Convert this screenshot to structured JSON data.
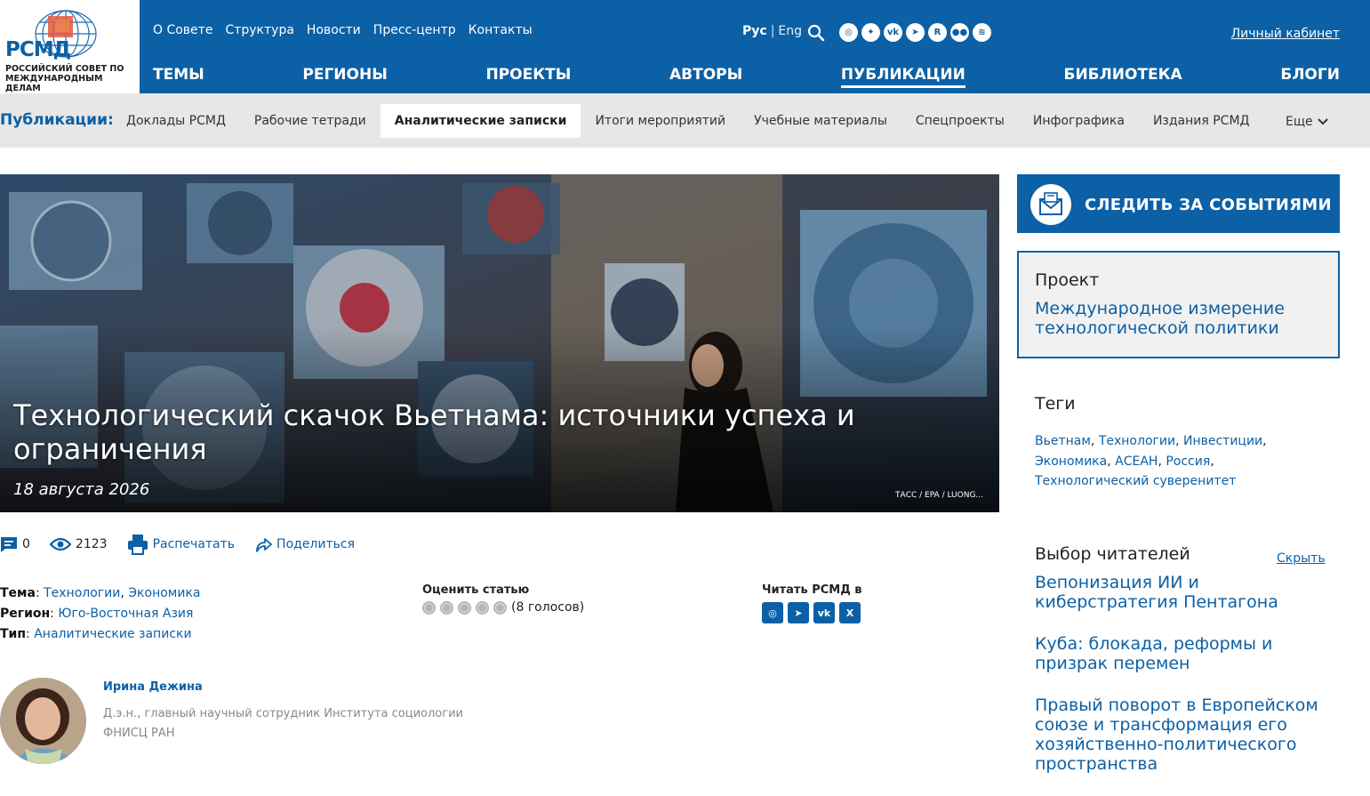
{
  "header": {
    "logo_abbr": "РСМД",
    "logo_full": "РОССИЙСКИЙ СОВЕТ ПО МЕЖДУНАРОДНЫМ ДЕЛАМ",
    "top_links": [
      "О Совете",
      "Структура",
      "Новости",
      "Пресс-центр",
      "Контакты"
    ],
    "lang_ru": "Рус",
    "lang_sep": "|",
    "lang_en": "Eng",
    "cabinet": "Личный кабинет",
    "main_nav": [
      "ТЕМЫ",
      "РЕГИОНЫ",
      "ПРОЕКТЫ",
      "АВТОРЫ",
      "ПУБЛИКАЦИИ",
      "БИБЛИОТЕКА",
      "БЛОГИ"
    ],
    "active_main": "ПУБЛИКАЦИИ",
    "social_icons": [
      "max-icon",
      "twitter-icon",
      "vk-icon",
      "telegram-icon",
      "rutube-icon",
      "flickr-icon",
      "rss-icon"
    ]
  },
  "subnav": {
    "label": "Публикации:",
    "items": [
      "Доклады РСМД",
      "Рабочие тетради",
      "Аналитические записки",
      "Итоги мероприятий",
      "Учебные материалы",
      "Спецпроекты",
      "Инфографика",
      "Издания РСМД"
    ],
    "active": "Аналитические записки",
    "more": "Еще"
  },
  "article": {
    "title": "Технологический скачок Вьетнама: источники успеха и ограничения",
    "date": "18 августа 2026",
    "photo_credit": "ТАСС / EPA / LUONG...",
    "comments": "0",
    "views": "2123",
    "print": "Распечатать",
    "share": "Поделиться",
    "theme_label": "Тема",
    "themes": [
      "Технологии",
      "Экономика"
    ],
    "region_label": "Регион",
    "region": "Юго-Восточная Азия",
    "type_label": "Тип",
    "type": "Аналитические записки",
    "rate_title": "Оценить статью",
    "votes": "(8 голосов)",
    "rating_max": 5,
    "read_title": "Читать РСМД в",
    "read_icons": [
      "max-icon",
      "telegram-icon",
      "vk-icon",
      "x-icon"
    ]
  },
  "author": {
    "name": "Ирина Дежина",
    "position": "Д.э.н., главный научный сотрудник Института социологии ФНИСЦ РАН"
  },
  "sidebar": {
    "follow": "СЛЕДИТЬ ЗА СОБЫТИЯМИ",
    "project_label": "Проект",
    "project_name": "Международное измерение технологической политики",
    "tags_title": "Теги",
    "tags": [
      "Вьетнам",
      "Технологии",
      "Инвестиции",
      "Экономика",
      "АСЕАН",
      "Россия",
      "Технологический суверенитет"
    ],
    "choice_title": "Выбор читателей",
    "hide": "Скрыть",
    "choice": [
      "Вепонизация ИИ и киберстратегия Пентагона",
      "Куба: блокада, реформы и призрак перемен",
      "Правый поворот в Европейском союзе и трансформация его хозяйственно-политического пространства"
    ]
  },
  "colors": {
    "brand": "#0c60a6",
    "subnav_bg": "#e7e7e7"
  }
}
